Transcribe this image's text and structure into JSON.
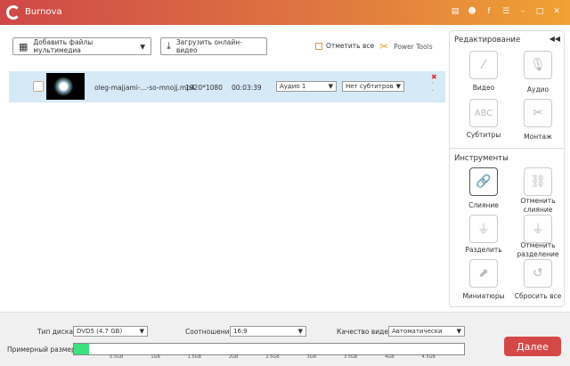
{
  "app": {
    "title": "Burnova",
    "accent": "#d54848"
  },
  "titlebar": {
    "icons": [
      "document-icon",
      "feedback-icon",
      "facebook-icon",
      "menu-icon",
      "minimize-icon",
      "maximize-icon",
      "close-icon"
    ]
  },
  "toolbar": {
    "add_media": "Добавить файлы мультимедиа",
    "download_online": "Загрузить онлайн-видео",
    "select_all": "Отметить все",
    "power_tools": "Power Tools"
  },
  "files": [
    {
      "name": "oleg-majjami-...-so-mnojj.mp4",
      "resolution": "1920*1080",
      "duration": "00:03:39",
      "audio": "Аудио 1",
      "subtitles": "Нет субтитров"
    }
  ],
  "panel": {
    "edit_title": "Редактирование",
    "edit_tools": [
      {
        "label": "Видео",
        "icon": "magic-wand-icon"
      },
      {
        "label": "Аудио",
        "icon": "microphone-icon"
      },
      {
        "label": "Субтитры",
        "icon": "abc-icon",
        "glyph": "ABC"
      },
      {
        "label": "Монтаж",
        "icon": "scissors-icon"
      }
    ],
    "tools_title": "Инструменты",
    "tools": [
      {
        "label": "Слияние",
        "icon": "link-icon"
      },
      {
        "label": "Отменить слияние",
        "icon": "unlink-icon"
      },
      {
        "label": "Разделить",
        "icon": "split-icon"
      },
      {
        "label": "Отменить разделение",
        "icon": "unsplit-icon"
      },
      {
        "label": "Миниатюры",
        "icon": "thumbnail-icon"
      },
      {
        "label": "Сбросить все",
        "icon": "reset-icon"
      }
    ]
  },
  "bottom": {
    "disc_type_label": "Тип диска",
    "disc_type": "DVD5 (4.7 GB)",
    "ratio_label": "Соотношение:",
    "ratio": "16:9",
    "quality_label": "Качество видео:",
    "quality": "Автоматически",
    "size_label": "Примерный размер:",
    "size_ticks": [
      "0.5GB",
      "1GB",
      "1.5GB",
      "2GB",
      "2.5GB",
      "3GB",
      "3.5GB",
      "4GB",
      "4.5GB"
    ],
    "size_used_gb": 0.19,
    "size_max_gb": 5,
    "next": "Далее"
  }
}
